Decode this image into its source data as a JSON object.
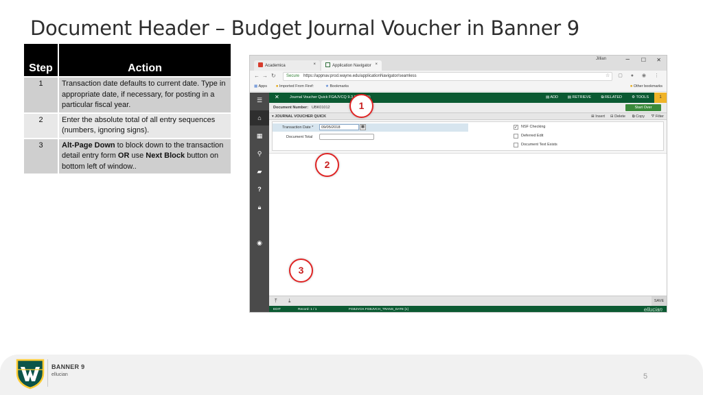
{
  "slide": {
    "title": "Document Header – Budget Journal Voucher in Banner 9",
    "page_number": "5"
  },
  "steps_table": {
    "headers": [
      "Step",
      "Action"
    ],
    "rows": [
      {
        "step": "1",
        "action": [
          {
            "text": "Transaction date defaults to current date. Type in appropriate date, if necessary, for posting in a particular fiscal year.",
            "bold": false
          }
        ]
      },
      {
        "step": "2",
        "action": [
          {
            "text": "Enter the absolute total of all entry sequences (numbers, ignoring signs).",
            "bold": false
          }
        ]
      },
      {
        "step": "3",
        "action": [
          {
            "text": "Alt-Page Down",
            "bold": true
          },
          {
            "text": " to block down to the transaction detail entry form ",
            "bold": false
          },
          {
            "text": "OR",
            "bold": true
          },
          {
            "text": " use ",
            "bold": false
          },
          {
            "text": "Next Block",
            "bold": true
          },
          {
            "text": " button on bottom left of window..",
            "bold": false
          }
        ]
      }
    ]
  },
  "browser": {
    "tabs": [
      {
        "label": "Academica",
        "active": false,
        "close": "×"
      },
      {
        "label": "Application Navigator",
        "active": true,
        "close": "×"
      }
    ],
    "window_user": "Jillian",
    "window_controls": {
      "minimize": "–",
      "maximize": "☐",
      "close": "✕"
    },
    "address": {
      "secure_label": "Secure",
      "url": "https://appnav.prod.wayne.edu/applicationNavigator/seamless"
    },
    "bookmarks": {
      "apps": "Apps",
      "imported": "Imported From Firef:",
      "bookmarks": "Bookmarks",
      "other": "Other bookmarks"
    }
  },
  "banner_form": {
    "close_glyph": "✕",
    "form_title": "Journal Voucher Quick FGAJVCQ 9.3.8 (PROD)",
    "toolbar": {
      "add": "ADD",
      "retrieve": "RETRIEVE",
      "related": "RELATED",
      "tools": "TOOLS",
      "notification_count": "1"
    },
    "document_number_label": "Document Number:",
    "document_number_value": "UBK01012",
    "start_over_label": "Start Over",
    "panel_title": "JOURNAL VOUCHER QUICK",
    "panel_actions": {
      "insert": "Insert",
      "delete": "Delete",
      "copy": "Copy",
      "filter": "Filter"
    },
    "fields": {
      "transaction_date_label": "Transaction Date *",
      "transaction_date_value": "09/05/2018",
      "document_total_label": "Document Total",
      "document_total_value": ""
    },
    "checkboxes": [
      {
        "label": "NSF Checking",
        "checked": true
      },
      {
        "label": "Deferred Edit",
        "checked": false
      },
      {
        "label": "Document Text Exists",
        "checked": false
      }
    ],
    "save_label": "SAVE",
    "status": {
      "mode": "EDIT",
      "record": "Record: 1 / 1",
      "field": "FGBJVCH.FGBJVCH_TRANS_DATE [1]",
      "brand": "ellucian"
    }
  },
  "callouts": [
    "1",
    "2",
    "3"
  ],
  "footer": {
    "product_name": "BANNER 9",
    "powered_by": "ellucian"
  },
  "colors": {
    "banner_green": "#0b5a32",
    "tools_yellow": "#f0b429",
    "callout_red": "#e02424",
    "wsu_green": "#0c5449",
    "wsu_gold": "#ffcc33"
  }
}
